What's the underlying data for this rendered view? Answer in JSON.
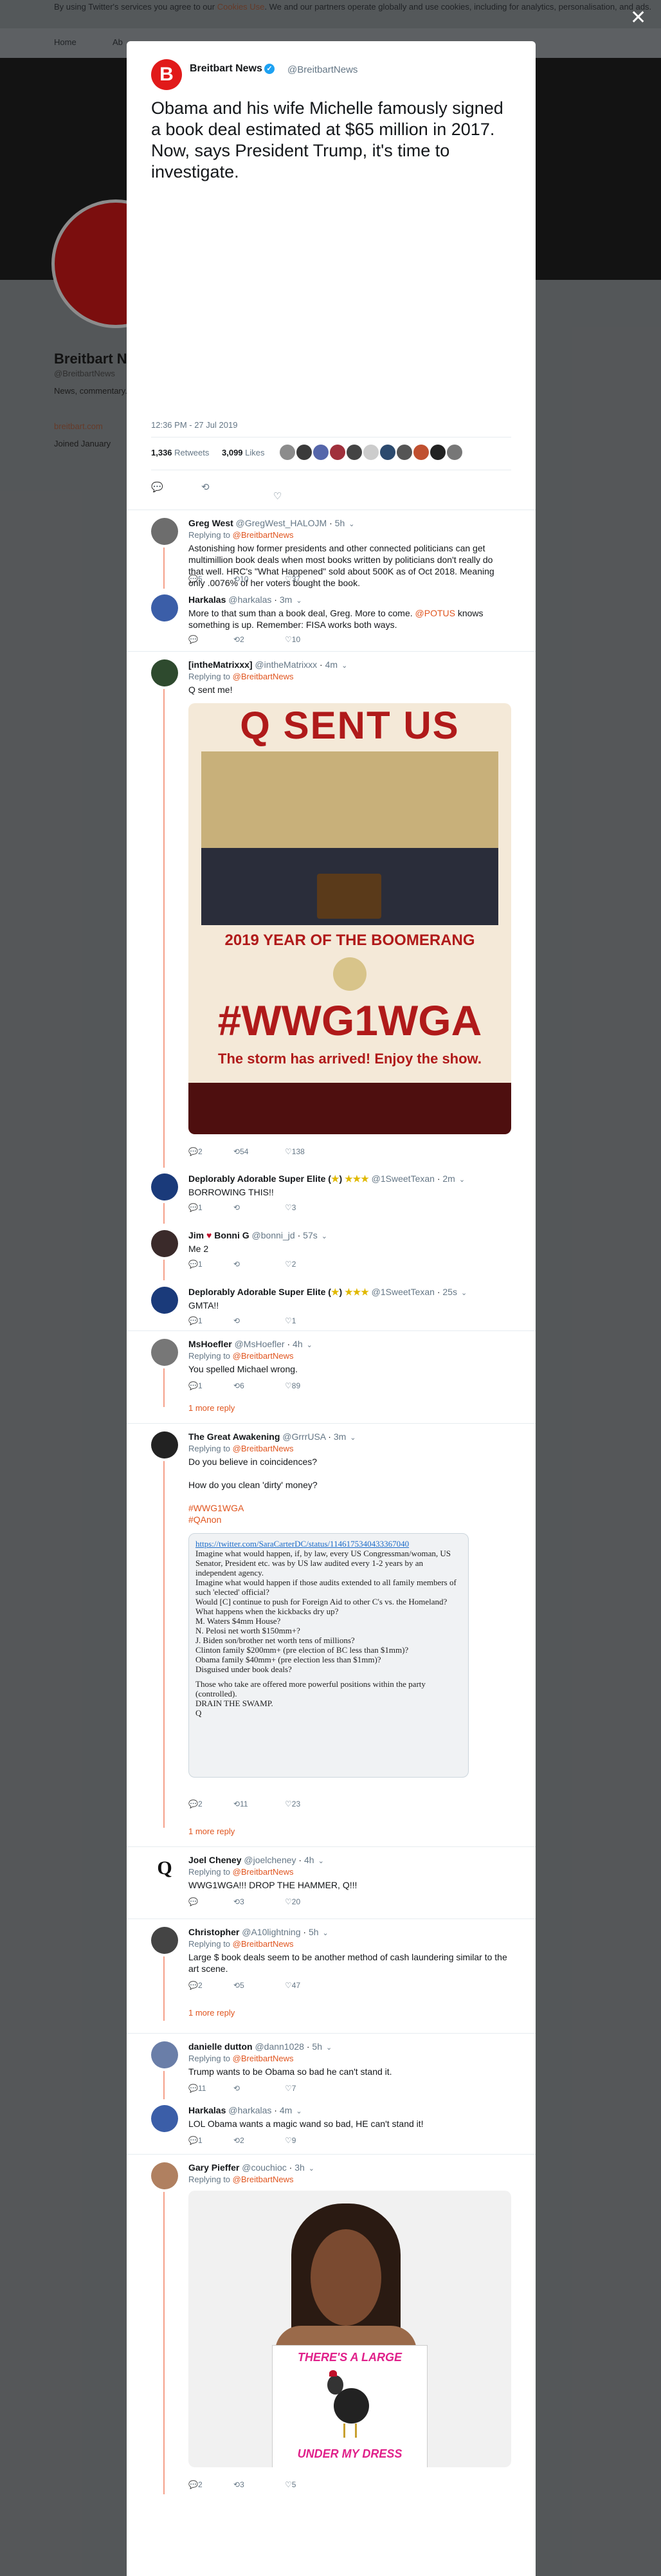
{
  "cookie": {
    "text_before": "By using Twitter's services you agree to our",
    "link": "Cookies Use",
    "text_after": ". We and our partners operate globally and use cookies, including for analytics, personalisation, and ads."
  },
  "background": {
    "nav_home": "Home",
    "nav_about": "Ab",
    "profile_name": "Breitbart N",
    "profile_handle": "@BreitbartNews",
    "profile_bio": "News, commentary... the political/media...",
    "profile_link": "breitbart.com",
    "profile_joined": "Joined January"
  },
  "modal": {
    "close_icon": "close-icon",
    "source_name": "Breitbart News",
    "source_handle": "@BreitbartNews",
    "tweet_text": "Obama and his wife Michelle famously signed a book deal estimated at $65 million in 2017. Now, says President Trump, it's time to investigate.",
    "timestamp": "12:36 PM - 27 Jul 2019",
    "retweets_count": "1,336",
    "retweets_label": "Retweets",
    "likes_count": "3,099",
    "likes_label": "Likes",
    "liker_colors": [
      "#8c8c8c",
      "#3a3a3a",
      "#5566aa",
      "#a0303c",
      "#444",
      "#ccc",
      "#2c4a6e",
      "#555",
      "#c05030",
      "#222",
      "#777"
    ]
  },
  "replies": [
    {
      "name": "Greg West",
      "handle": "@GregWest_HALOJM",
      "time": "5h",
      "replying_to": "@BreitbartNews",
      "text": "Astonishing how former presidents and other connected politicians can get multimillion book deals when most books written by politicians don't really do that well. HRC's \"What Happened\" sold about 500K as of Oct 2018. Meaning only .0076% of her voters bought the book.",
      "replies": "5",
      "retweets": "10",
      "likes": "37"
    },
    {
      "name": "Harkalas",
      "handle": "@harkalas",
      "time": "3m",
      "text_before": "More to that sum than a book deal, Greg. More to come.",
      "mention": "@POTUS",
      "text_after": "knows something is up. Remember: FISA works both ways.",
      "replies": "",
      "retweets": "2",
      "likes": "10"
    },
    {
      "name": "[intheMatrixxx]",
      "handle": "@intheMatrixxx",
      "time": "4m",
      "replying_to": "@BreitbartNews",
      "text": "Q sent me!",
      "image_top": "Q SENT US",
      "image_mid": "2019 YEAR OF THE BOOMERANG",
      "image_tag": "#WWG1WGA",
      "image_bottom": "The storm has arrived! Enjoy the show.",
      "replies": "2",
      "retweets": "54",
      "likes": "138"
    },
    {
      "name": "Deplorably Adorable Super Elite (",
      "name_star": "★",
      "name_end": ")",
      "stars": "★★★",
      "handle": "@1SweetTexan",
      "time": "2m",
      "text": "BORROWING THIS!!",
      "replies": "1",
      "retweets": "",
      "likes": "3"
    },
    {
      "name": "Jim",
      "name_heart": "♥",
      "name2": "Bonni G",
      "handle": "@bonni_jd",
      "time": "57s",
      "text": "Me 2",
      "replies": "1",
      "retweets": "",
      "likes": "2"
    },
    {
      "name": "Deplorably Adorable Super Elite (",
      "name_star": "★",
      "name_end": ")",
      "stars": "★★★",
      "handle": "@1SweetTexan",
      "time": "25s",
      "text": "GMTA!!",
      "replies": "1",
      "retweets": "",
      "likes": "1"
    },
    {
      "name": "MsHoefler",
      "handle": "@MsHoefler",
      "time": "4h",
      "replying_to": "@BreitbartNews",
      "text": "You spelled Michael wrong.",
      "replies": "1",
      "retweets": "6",
      "likes": "89",
      "more": "1 more reply"
    },
    {
      "name": "The Great Awakening",
      "handle": "@GrrrUSA",
      "time": "3m",
      "replying_to": "@BreitbartNews",
      "text1": "Do you believe in coincidences?",
      "text2": "How do you clean 'dirty' money?",
      "hashtag1": "#WWG1WGA",
      "hashtag2": "#QAnon",
      "card_link": "https://twitter.com/SaraCarterDC/status/1146175340433367040",
      "card_lines": [
        "Imagine what would happen, if, by law, every US Congressman/woman, US Senator, President etc. was by US law audited every 1-2 years by an independent agency.",
        "Imagine what would happen if those audits extended to all family members of such 'elected' official?",
        "Would [C] continue to push for Foreign Aid to other C's vs. the Homeland?",
        "What happens when the kickbacks dry up?",
        "M. Waters $4mm House?",
        "N. Pelosi net worth $150mm+?",
        "J. Biden son/brother net worth tens of millions?",
        "Clinton family $200mm+ (pre election of BC less than $1mm)?",
        "Obama family $40mm+ (pre election less than $1mm)?",
        "Disguised under book deals?",
        "Those who take are offered more powerful positions within the party (controlled).",
        "DRAIN THE SWAMP.",
        "Q"
      ],
      "replies": "2",
      "retweets": "11",
      "likes": "23",
      "more": "1 more reply"
    },
    {
      "name": "Joel Cheney",
      "handle": "@joelcheney",
      "time": "4h",
      "replying_to": "@BreitbartNews",
      "text": "WWG1WGA!!! DROP THE HAMMER, Q!!!",
      "replies": "",
      "retweets": "3",
      "likes": "20"
    },
    {
      "name": "Christopher",
      "handle": "@A10lightning",
      "time": "5h",
      "replying_to": "@BreitbartNews",
      "text": "Large $ book deals seem to be another method of cash laundering similar to the art scene.",
      "replies": "2",
      "retweets": "5",
      "likes": "47",
      "more": "1 more reply"
    },
    {
      "name": "danielle dutton",
      "handle": "@dann1028",
      "time": "5h",
      "replying_to": "@BreitbartNews",
      "text": "Trump wants to be Obama so bad he can't stand it.",
      "replies": "11",
      "retweets": "",
      "likes": "7"
    },
    {
      "name": "Harkalas",
      "handle": "@harkalas",
      "time": "4m",
      "text": "LOL Obama wants a magic wand so bad, HE can't stand it!",
      "replies": "1",
      "retweets": "2",
      "likes": "9"
    },
    {
      "name": "Gary Pieffer",
      "handle": "@couchioc",
      "time": "3h",
      "replying_to": "@BreitbartNews",
      "image_sign1": "THERE'S A LARGE",
      "image_sign2": "UNDER MY DRESS",
      "replies": "2",
      "retweets": "3",
      "likes": "5"
    }
  ],
  "colors": {
    "accent": "#e0551f",
    "brand_red": "#e11a1a",
    "verified": "#1da1f2"
  }
}
